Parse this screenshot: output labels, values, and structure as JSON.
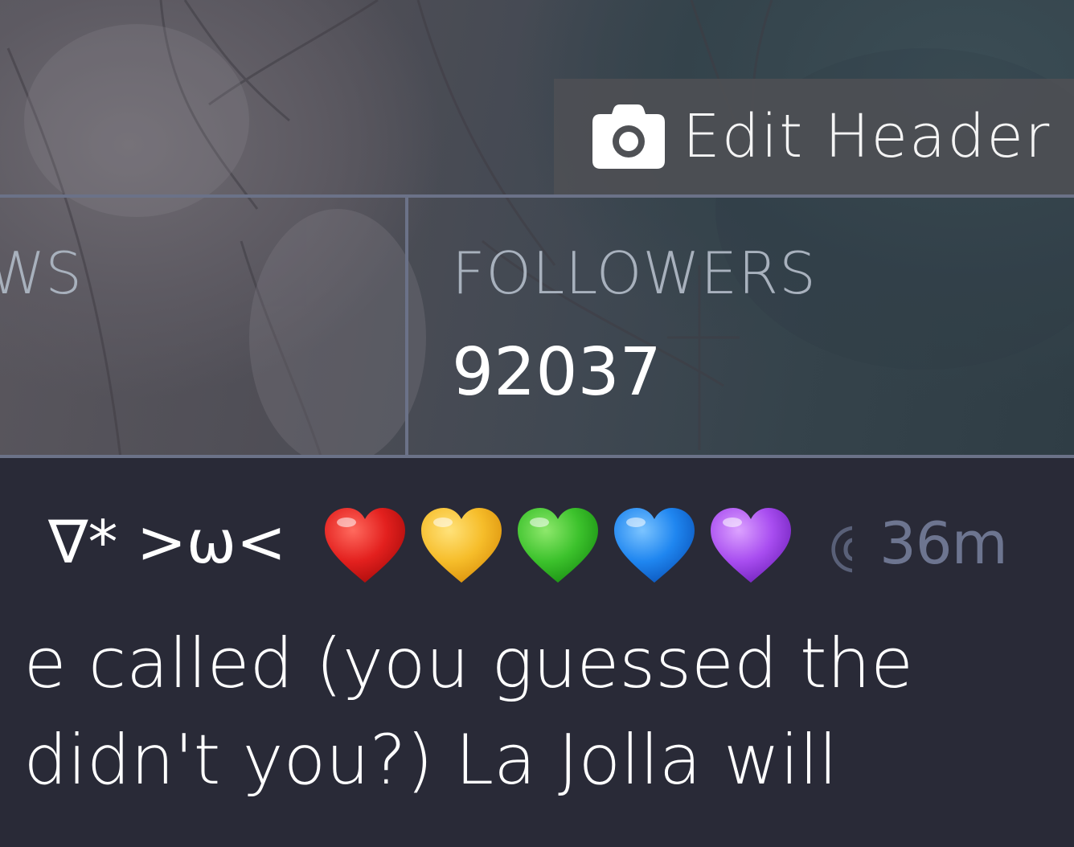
{
  "header": {
    "edit_button": {
      "icon": "camera-icon",
      "label": "Edit Header"
    }
  },
  "stats": {
    "views_label_fragment": "WS",
    "followers_label": "FOLLOWERS",
    "followers_value": "92037"
  },
  "post": {
    "display_name_fragment": "∇* >ω<",
    "hearts": [
      {
        "icon": "red-heart-icon",
        "color": "#e3201e"
      },
      {
        "icon": "yellow-heart-icon",
        "color": "#f6bd2a"
      },
      {
        "icon": "green-heart-icon",
        "color": "#3cc22c"
      },
      {
        "icon": "blue-heart-icon",
        "color": "#1f86f0"
      },
      {
        "icon": "purple-heart-icon",
        "color": "#a84df0"
      }
    ],
    "handle_fragment": "@",
    "time": "36m",
    "text_lines": [
      "e called (you guessed the",
      "didn't you?) La Jolla will",
      ""
    ]
  },
  "colors": {
    "page_bg": "#292a37",
    "divider": "#6b7288",
    "label_muted": "#a8b1bd",
    "timestamp": "#6d7590"
  }
}
